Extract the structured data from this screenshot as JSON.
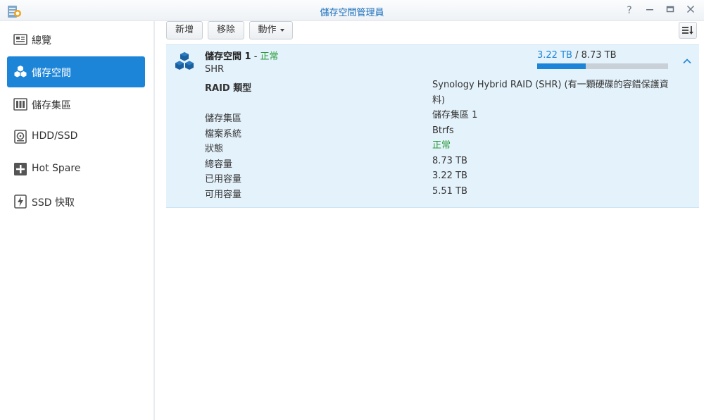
{
  "window": {
    "title": "儲存空間管理員",
    "controls": [
      "help-icon",
      "minimize-icon",
      "maximize-icon",
      "close-icon"
    ]
  },
  "sidebar": {
    "items": [
      {
        "label": "總覽",
        "icon": "overview-icon",
        "active": false
      },
      {
        "label": "儲存空間",
        "icon": "volume-cubes-icon",
        "active": true
      },
      {
        "label": "儲存集區",
        "icon": "storage-pool-icon",
        "active": false
      },
      {
        "label": "HDD/SSD",
        "icon": "disk-icon",
        "active": false
      },
      {
        "label": "Hot Spare",
        "icon": "hot-spare-icon",
        "active": false
      },
      {
        "label": "SSD 快取",
        "icon": "ssd-cache-icon",
        "active": false
      }
    ]
  },
  "toolbar": {
    "create_label": "新增",
    "remove_label": "移除",
    "action_label": "動作"
  },
  "volume": {
    "name": "儲存空間 1",
    "separator": " - ",
    "status": "正常",
    "raid_short": "SHR",
    "used": "3.22 TB",
    "usage_separator": " / ",
    "total": "8.73 TB",
    "used_fraction": 0.369,
    "details": [
      {
        "label": "RAID 類型",
        "value": "Synology Hybrid RAID (SHR) (有一顆硬碟的容錯保護資料)"
      },
      {
        "label": "儲存集區",
        "value": "儲存集區 1"
      },
      {
        "label": "檔案系統",
        "value": "Btrfs"
      },
      {
        "label": "狀態",
        "value": "正常"
      },
      {
        "label": "總容量",
        "value": "8.73 TB"
      },
      {
        "label": "已用容量",
        "value": "3.22 TB"
      },
      {
        "label": "可用容量",
        "value": "5.51 TB"
      }
    ]
  },
  "colors": {
    "accent": "#1d85d8",
    "status_ok": "#2a9a3a",
    "panel_bg": "#e4f2fb"
  }
}
